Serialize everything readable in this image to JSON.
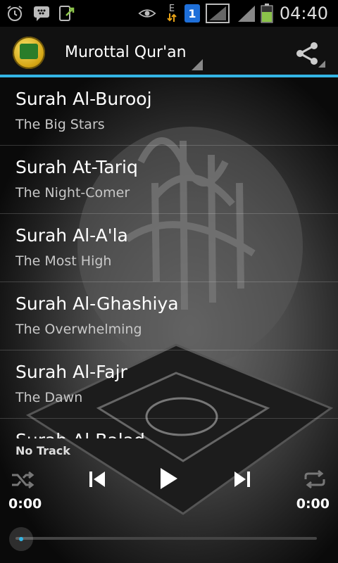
{
  "status": {
    "time": "04:40",
    "network_label": "E",
    "sim_badge": "1",
    "icons": [
      "alarm-icon",
      "bbm-icon",
      "screen-share-icon",
      "eye-icon",
      "data-arrows-icon",
      "signal-icon",
      "signal-icon",
      "battery-icon"
    ]
  },
  "actionbar": {
    "title": "Murottal Qur'an",
    "share_icon": "share-icon"
  },
  "surahs": [
    {
      "title": "Surah Al-Burooj",
      "subtitle": "The Big Stars"
    },
    {
      "title": "Surah At-Tariq",
      "subtitle": "The Night-Comer"
    },
    {
      "title": "Surah Al-A'la",
      "subtitle": "The Most High"
    },
    {
      "title": "Surah Al-Ghashiya",
      "subtitle": "The Overwhelming"
    },
    {
      "title": "Surah Al-Fajr",
      "subtitle": "The Dawn"
    },
    {
      "title": "Surah Al-Balad",
      "subtitle": ""
    }
  ],
  "player": {
    "track": "No Track",
    "elapsed": "0:00",
    "duration": "0:00",
    "progress": 0
  },
  "colors": {
    "accent": "#33b5e5",
    "battery": "#8bc34a"
  }
}
